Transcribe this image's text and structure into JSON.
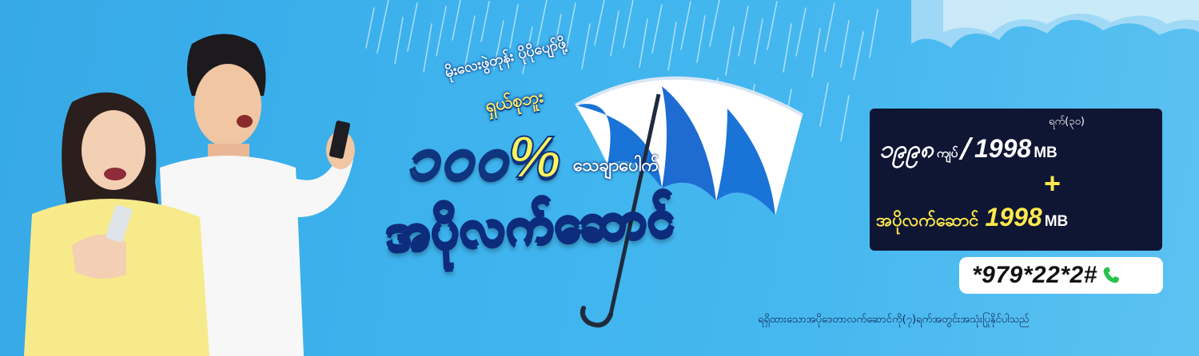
{
  "promo": {
    "tagline_top": "မိုးလေးဖွဲတုန်း ပိုပိုပျော်ဖို့",
    "tagline_brand": "ရှယ်စုဘူး",
    "bonus_percent": "၁၀၀%",
    "bonus_word": "သေချာပေါက်",
    "main_title": "အပိုလက်ဆောင်"
  },
  "offer": {
    "duration": "ရက်(၃၀)",
    "price": "၁၉၉၈",
    "currency": "ကျပ်",
    "separator": "/",
    "data_amount": "1998",
    "data_unit": "MB",
    "plus_sign": "+",
    "bonus_label": "အပိုလက်ဆောင်",
    "bonus_amount": "1998",
    "bonus_unit": "MB"
  },
  "dial": {
    "code": "*979*22*2#",
    "icon": "phone-icon"
  },
  "footnote": "ရရှိထားသောအပိုဒေတာလက်ဆောင်ကို(၇)ရက်အတွင်းအသုံးပြုနိုင်ပါသည်",
  "colors": {
    "background": "#3fb4ee",
    "accent_yellow": "#ffe94d",
    "dark_navy": "#0f1634",
    "phone_green": "#27c24c"
  }
}
